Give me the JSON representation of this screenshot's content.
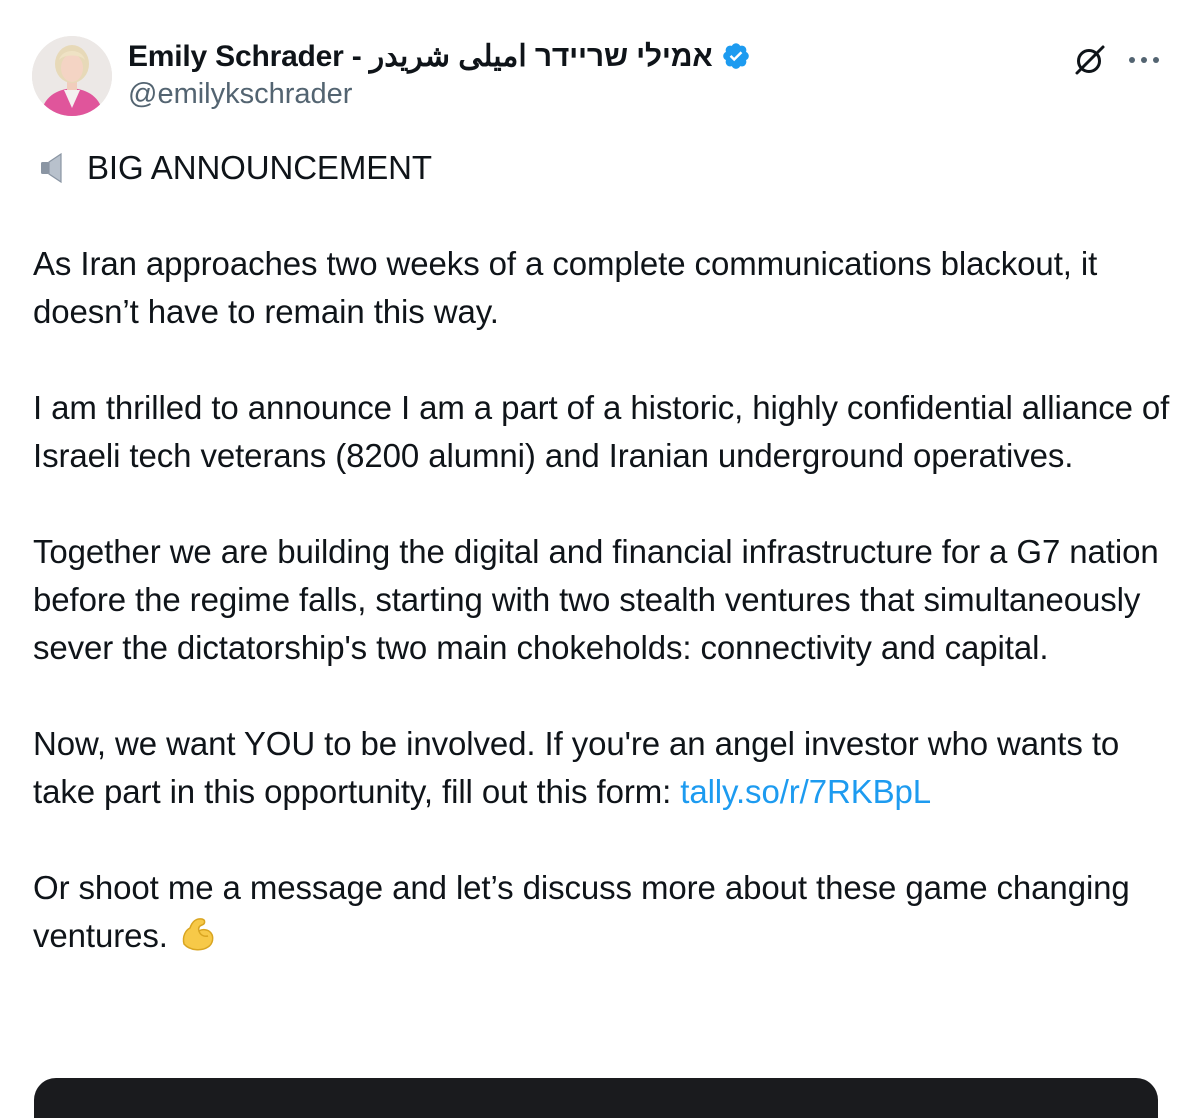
{
  "author": {
    "display_name": "Emily Schrader - אמילי שריידר امیلی شریدر",
    "handle": "@emilykschrader",
    "verified": true,
    "verified_color": "#1d9bf0"
  },
  "icons": {
    "avatar": "profile-photo",
    "verified": "verified-badge-icon",
    "grok": "grok-icon",
    "more": "more-options-icon",
    "speaker": "speaker-icon",
    "flexed_biceps": "flexed-biceps-emoji"
  },
  "tweet": {
    "announcement": "BIG ANNOUNCEMENT",
    "paragraph_1": "As Iran approaches two weeks of a complete communications blackout, it doesn’t have to remain this way.",
    "paragraph_2": "I am thrilled to announce I am a part of a historic, highly confidential alliance of Israeli tech veterans (8200 alumni) and Iranian underground operatives.",
    "paragraph_3": "Together we are building the digital and financial infrastructure for a G7 nation before the regime falls, starting with two stealth ventures that simultaneously sever the dictatorship's two main chokeholds: connectivity and capital.",
    "paragraph_4_text": "Now, we want YOU to be involved. If you're an angel investor who wants to take part in this opportunity, fill out this form: ",
    "paragraph_4_link": "tally.so/r/7RKBpL",
    "paragraph_5": "Or shoot me a message and let’s discuss more about these game changing ventures."
  },
  "colors": {
    "text": "#0f1419",
    "secondary": "#536471",
    "link": "#1d9bf0"
  }
}
